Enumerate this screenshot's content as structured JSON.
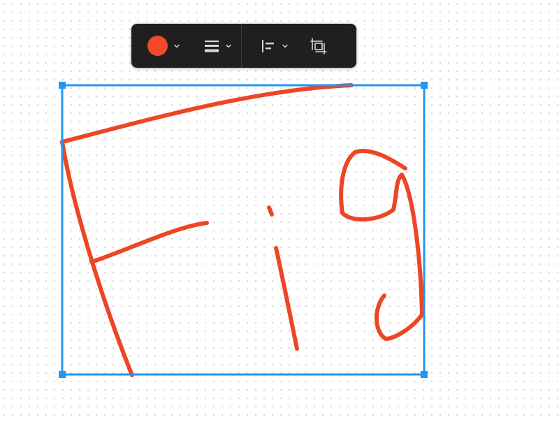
{
  "canvas": {
    "background": "#ffffff",
    "dot_color": "#cfcfcf"
  },
  "toolbar": {
    "background": "#1f1f1f",
    "stroke_color": {
      "value": "#f04a2a",
      "icon": "color-swatch"
    },
    "stroke_style": {
      "icon": "hamburger-lines-icon"
    },
    "alignment": {
      "icon": "align-left-icon"
    },
    "frame_selection": {
      "icon": "frame-selection-icon"
    },
    "dropdown_icon": "chevron-down-icon",
    "icon_color": "#d8d8d8"
  },
  "selection": {
    "color": "#2196f3"
  },
  "drawing": {
    "color": "#ec4626",
    "strokes": 9
  }
}
